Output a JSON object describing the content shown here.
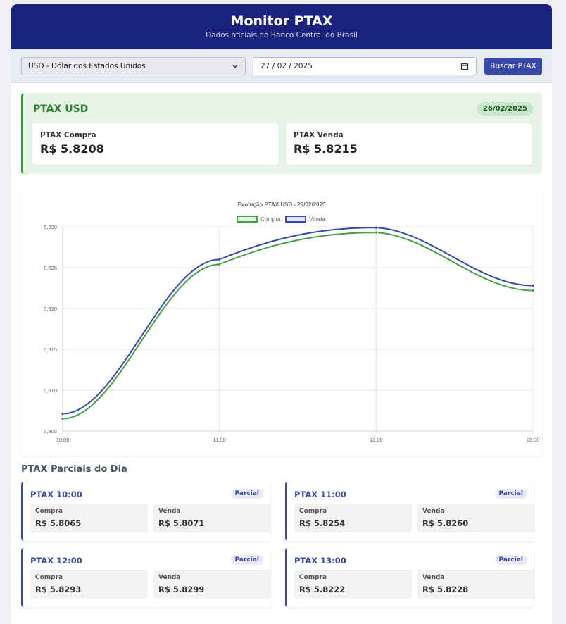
{
  "header": {
    "title": "Monitor PTAX",
    "subtitle": "Dados oficiais do Banco Central do Brasil"
  },
  "controls": {
    "currency_selected": "USD - Dólar dos Estados Unidos",
    "date_value": "27 / 02 / 2025",
    "search_label": "Buscar PTAX"
  },
  "summary": {
    "title": "PTAX USD",
    "date": "26/02/2025",
    "buy_label": "PTAX Compra",
    "buy_value": "R$ 5.8208",
    "sell_label": "PTAX Venda",
    "sell_value": "R$ 5.8215"
  },
  "chart_data": {
    "type": "line",
    "title": "Evolução PTAX USD - 26/02/2025",
    "x": [
      "10:00",
      "11:00",
      "12:00",
      "13:00"
    ],
    "y_ticks": [
      "5,830",
      "5,825",
      "5,820",
      "5,815",
      "5,810",
      "5,805"
    ],
    "ylim": [
      5.805,
      5.83
    ],
    "grid": true,
    "legend": "top-center",
    "series": [
      {
        "name": "Compra",
        "values": [
          5.8065,
          5.8254,
          5.8293,
          5.8222
        ],
        "color": "#43a047"
      },
      {
        "name": "Venda",
        "values": [
          5.8071,
          5.826,
          5.8299,
          5.8228
        ],
        "color": "#3949ab"
      }
    ]
  },
  "partials": {
    "title": "PTAX Parciais do Dia",
    "badge": "Parcial",
    "buy_label": "Compra",
    "sell_label": "Venda",
    "items": [
      {
        "title": "PTAX 10:00",
        "buy": "R$ 5.8065",
        "sell": "R$ 5.8071"
      },
      {
        "title": "PTAX 11:00",
        "buy": "R$ 5.8254",
        "sell": "R$ 5.8260"
      },
      {
        "title": "PTAX 12:00",
        "buy": "R$ 5.8293",
        "sell": "R$ 5.8299"
      },
      {
        "title": "PTAX 13:00",
        "buy": "R$ 5.8222",
        "sell": "R$ 5.8228"
      }
    ]
  }
}
